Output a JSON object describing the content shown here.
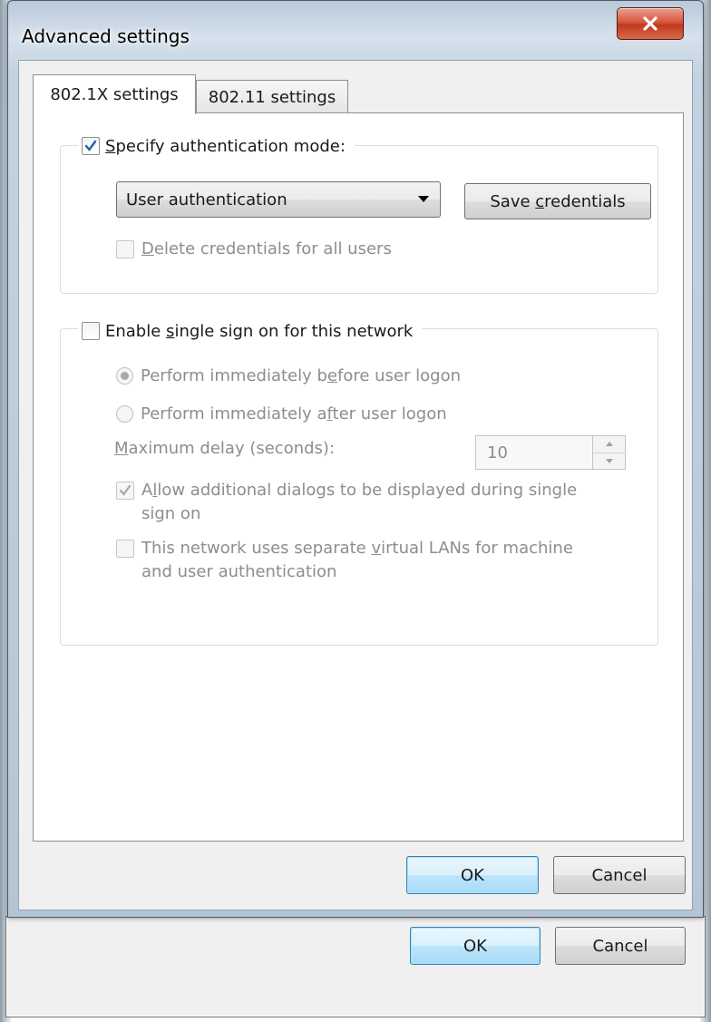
{
  "window": {
    "title": "Advanced settings",
    "close_glyph": "x"
  },
  "tabs": [
    {
      "label": "802.1X settings",
      "active": true
    },
    {
      "label": "802.11 settings",
      "active": false
    }
  ],
  "auth_group": {
    "checkbox_label": "Specify authentication mode:",
    "checked": true,
    "mode_value": "User authentication",
    "save_button": "Save credentials",
    "delete_label": "Delete credentials for all users",
    "delete_checked": false
  },
  "sso_group": {
    "checkbox_label": "Enable single sign on for this network",
    "checked": false,
    "radio_before": "Perform immediately before user logon",
    "radio_after": "Perform immediately after user logon",
    "selected_radio": "before",
    "delay_label": "Maximum delay (seconds):",
    "delay_value": "10",
    "allow_dialogs_label_line1": "Allow additional dialogs to be displayed during single",
    "allow_dialogs_label_line2": "sign on",
    "allow_dialogs_checked": true,
    "vlan_label_line1": "This network uses separate virtual LANs for machine",
    "vlan_label_line2": "and user authentication",
    "vlan_checked": false
  },
  "buttons": {
    "ok": "OK",
    "cancel": "Cancel"
  },
  "background_window": {
    "ok": "OK",
    "cancel": "Cancel"
  },
  "colors": {
    "accent_check": "#2a5ea8",
    "disabled_text": "#8d8d8d",
    "close_red": "#c03a1f"
  },
  "icons": {
    "close": "close-icon",
    "check": "checkmark-icon",
    "dropdown": "chevron-down-icon"
  }
}
